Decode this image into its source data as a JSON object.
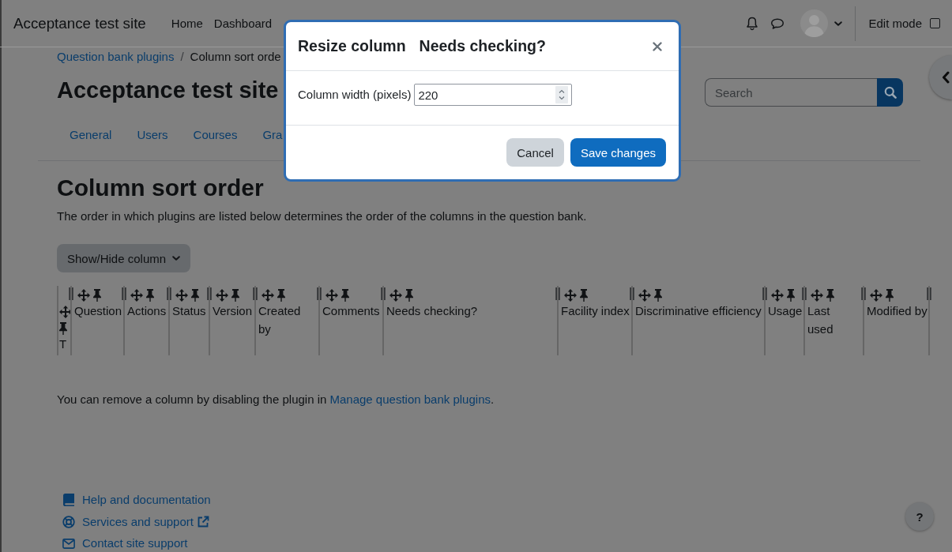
{
  "navbar": {
    "brand": "Acceptance test site",
    "links": [
      {
        "label": "Home"
      },
      {
        "label": "Dashboard"
      }
    ],
    "edit_mode": {
      "label": "Edit mode",
      "checked": false
    }
  },
  "breadcrumb": {
    "separator": "/",
    "items": [
      {
        "label": "Question bank plugins",
        "kind": "link"
      },
      {
        "label": "Column sort orde",
        "kind": "current"
      }
    ]
  },
  "page_header": {
    "title": "Acceptance test site",
    "search": {
      "placeholder": "Search"
    }
  },
  "tabs": [
    {
      "label": "General",
      "selected": false
    },
    {
      "label": "Users",
      "selected": false
    },
    {
      "label": "Courses",
      "selected": false
    },
    {
      "label": "Gra",
      "selected": false
    }
  ],
  "content": {
    "title": "Column sort order",
    "intro": "The order in which plugins are listed below determines the order of the columns in the question bank.",
    "show_hide_button": "Show/Hide column",
    "columns": [
      {
        "name": "T"
      },
      {
        "name": "Question"
      },
      {
        "name": "Actions"
      },
      {
        "name": "Status"
      },
      {
        "name": "Version"
      },
      {
        "name": "Created by"
      },
      {
        "name": "Comments"
      },
      {
        "name": "Needs checking?"
      },
      {
        "name": "Facility index"
      },
      {
        "name": "Discriminative efficiency"
      },
      {
        "name": "Usage"
      },
      {
        "name": "Last used"
      },
      {
        "name": "Modified by"
      }
    ],
    "note": {
      "text": "You can remove a column by disabling the plugin in ",
      "link": "Manage question bank plugins",
      "end": "."
    }
  },
  "footer": {
    "links": [
      {
        "label": "Help and documentation",
        "kind": "help",
        "external": false
      },
      {
        "label": "Services and support",
        "kind": "support",
        "external": true
      },
      {
        "label": "Contact site support",
        "kind": "contact",
        "external": false
      }
    ]
  },
  "help_button": "?",
  "modal": {
    "title": "Resize column",
    "column": "Needs checking?",
    "field": {
      "label": "Column width (pixels)",
      "value": "220"
    },
    "buttons": [
      {
        "label": "Cancel",
        "kind": "secondary"
      },
      {
        "label": "Save changes",
        "kind": "primary"
      }
    ]
  }
}
